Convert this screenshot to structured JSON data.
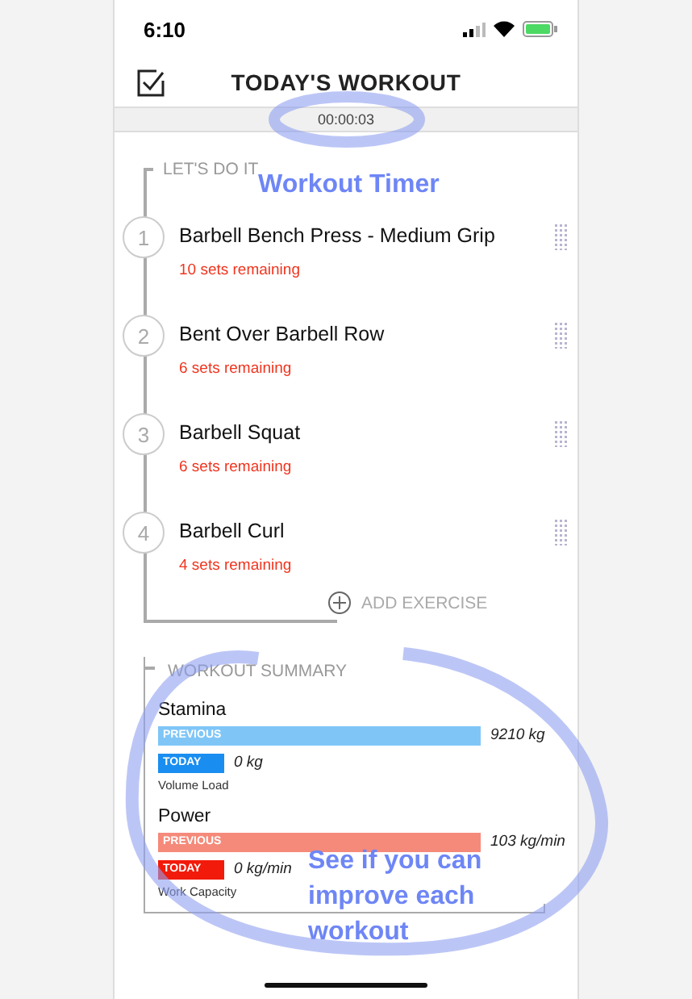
{
  "status_bar": {
    "time": "6:10"
  },
  "header": {
    "title": "TODAY'S WORKOUT"
  },
  "timer": "00:00:03",
  "exercise_list": {
    "heading": "LET'S DO IT",
    "exercises": [
      {
        "number": "1",
        "name": "Barbell Bench Press - Medium Grip",
        "sets": "10 sets remaining"
      },
      {
        "number": "2",
        "name": "Bent Over Barbell Row",
        "sets": "6 sets remaining"
      },
      {
        "number": "3",
        "name": "Barbell Squat",
        "sets": "6 sets remaining"
      },
      {
        "number": "4",
        "name": "Barbell Curl",
        "sets": "4 sets remaining"
      }
    ],
    "add_button": "ADD EXERCISE"
  },
  "summary": {
    "heading": "WORKOUT SUMMARY",
    "metrics": [
      {
        "name": "Stamina",
        "previous": {
          "label": "PREVIOUS",
          "reading": "9210 kg",
          "color": "#7fc6f7"
        },
        "today": {
          "label": "TODAY",
          "reading": "0 kg",
          "color": "#1a8ef0"
        },
        "caption": "Volume Load"
      },
      {
        "name": "Power",
        "previous": {
          "label": "PREVIOUS",
          "reading": "103 kg/min",
          "color": "#f58a7a"
        },
        "today": {
          "label": "TODAY",
          "reading": "0 kg/min",
          "color": "#f21a0a"
        },
        "caption": "Work Capacity"
      }
    ]
  },
  "annotations": [
    {
      "text": "Workout Timer"
    },
    {
      "text": "See if you can improve each workout"
    }
  ]
}
